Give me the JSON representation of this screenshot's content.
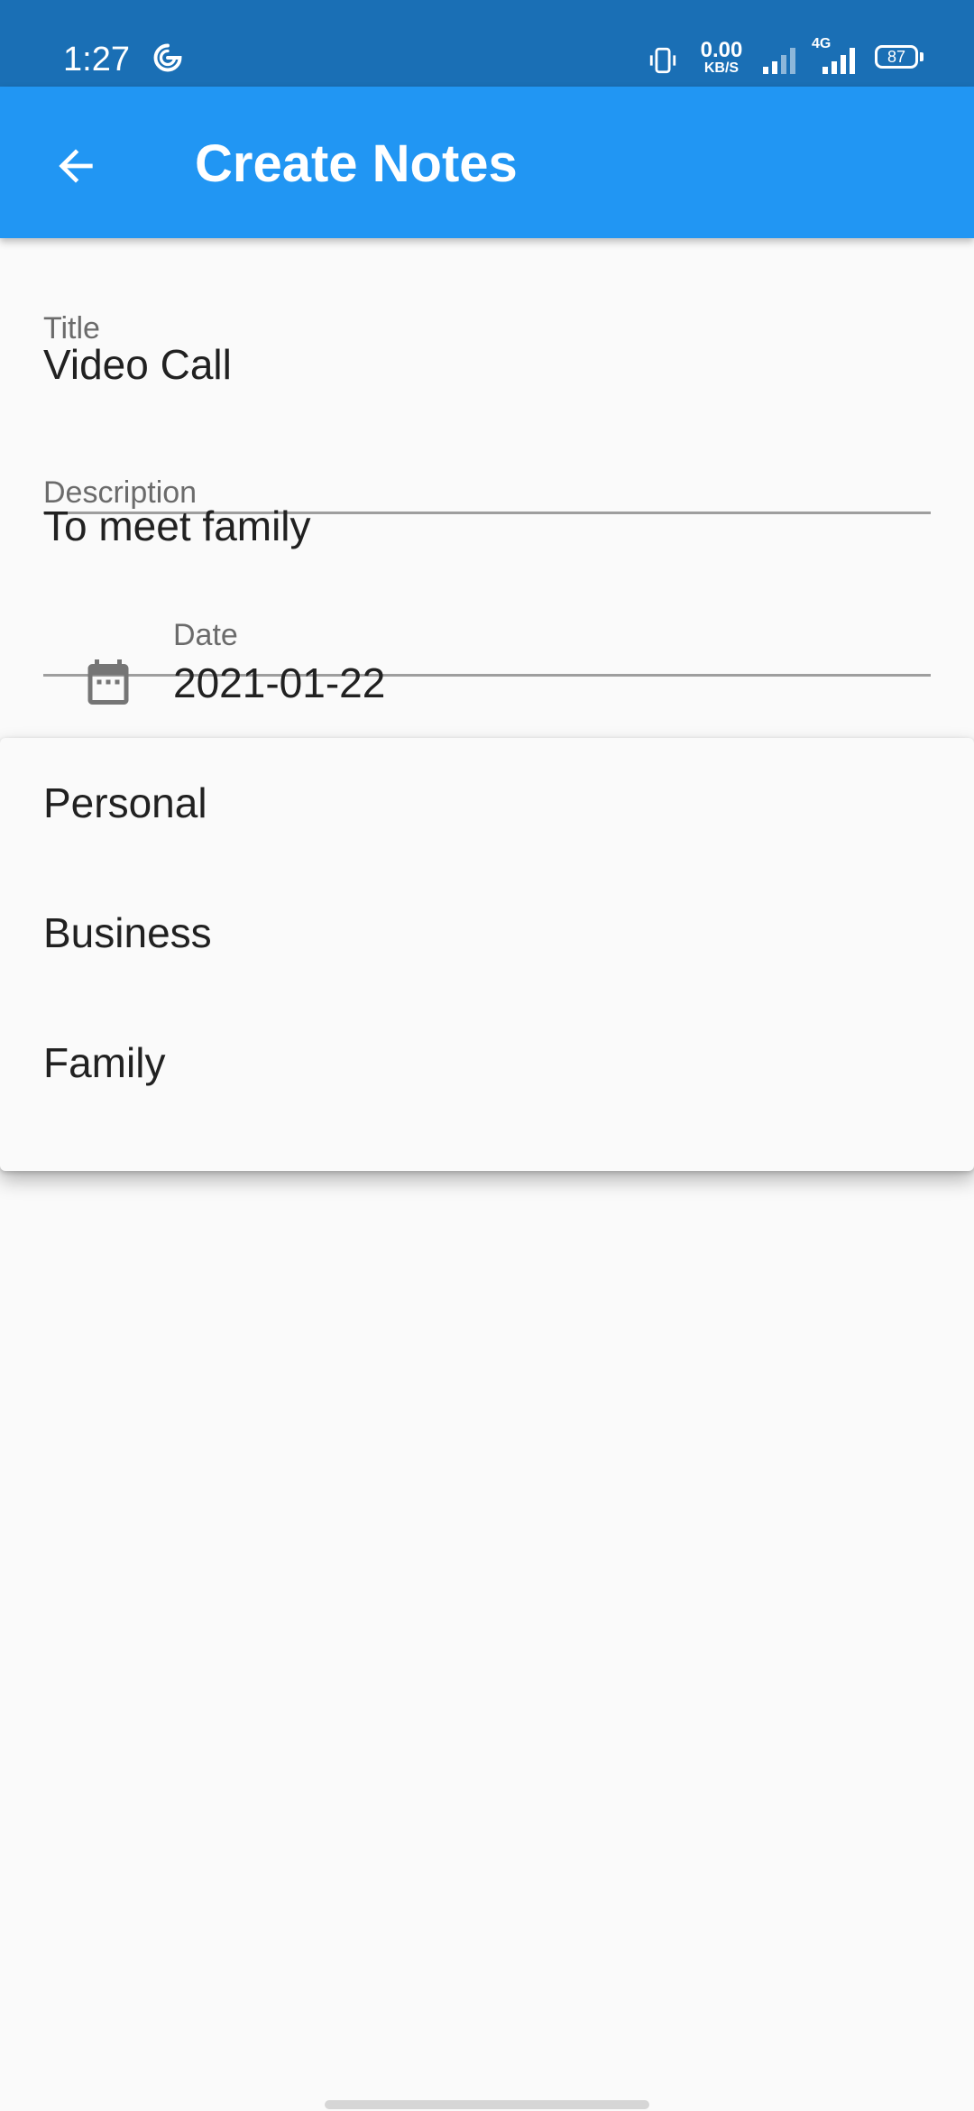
{
  "status_bar": {
    "time": "1:27",
    "carrier_icon": "g-icon",
    "network_speed_value": "0.00",
    "network_speed_unit": "KB/S",
    "network_type": "4G",
    "battery_level": "87",
    "background_color": "#1a6fb5"
  },
  "app_bar": {
    "title": "Create Notes",
    "back_icon": "arrow-back-icon",
    "background_color": "#2196f3"
  },
  "form": {
    "title_field": {
      "label": "Title",
      "value": "Video Call"
    },
    "description_field": {
      "label": "Description",
      "value": "To meet family"
    },
    "date_field": {
      "label": "Date",
      "value": "2021-01-22",
      "icon": "calendar-icon"
    }
  },
  "dropdown": {
    "options": [
      "Personal",
      "Business",
      "Family"
    ]
  }
}
